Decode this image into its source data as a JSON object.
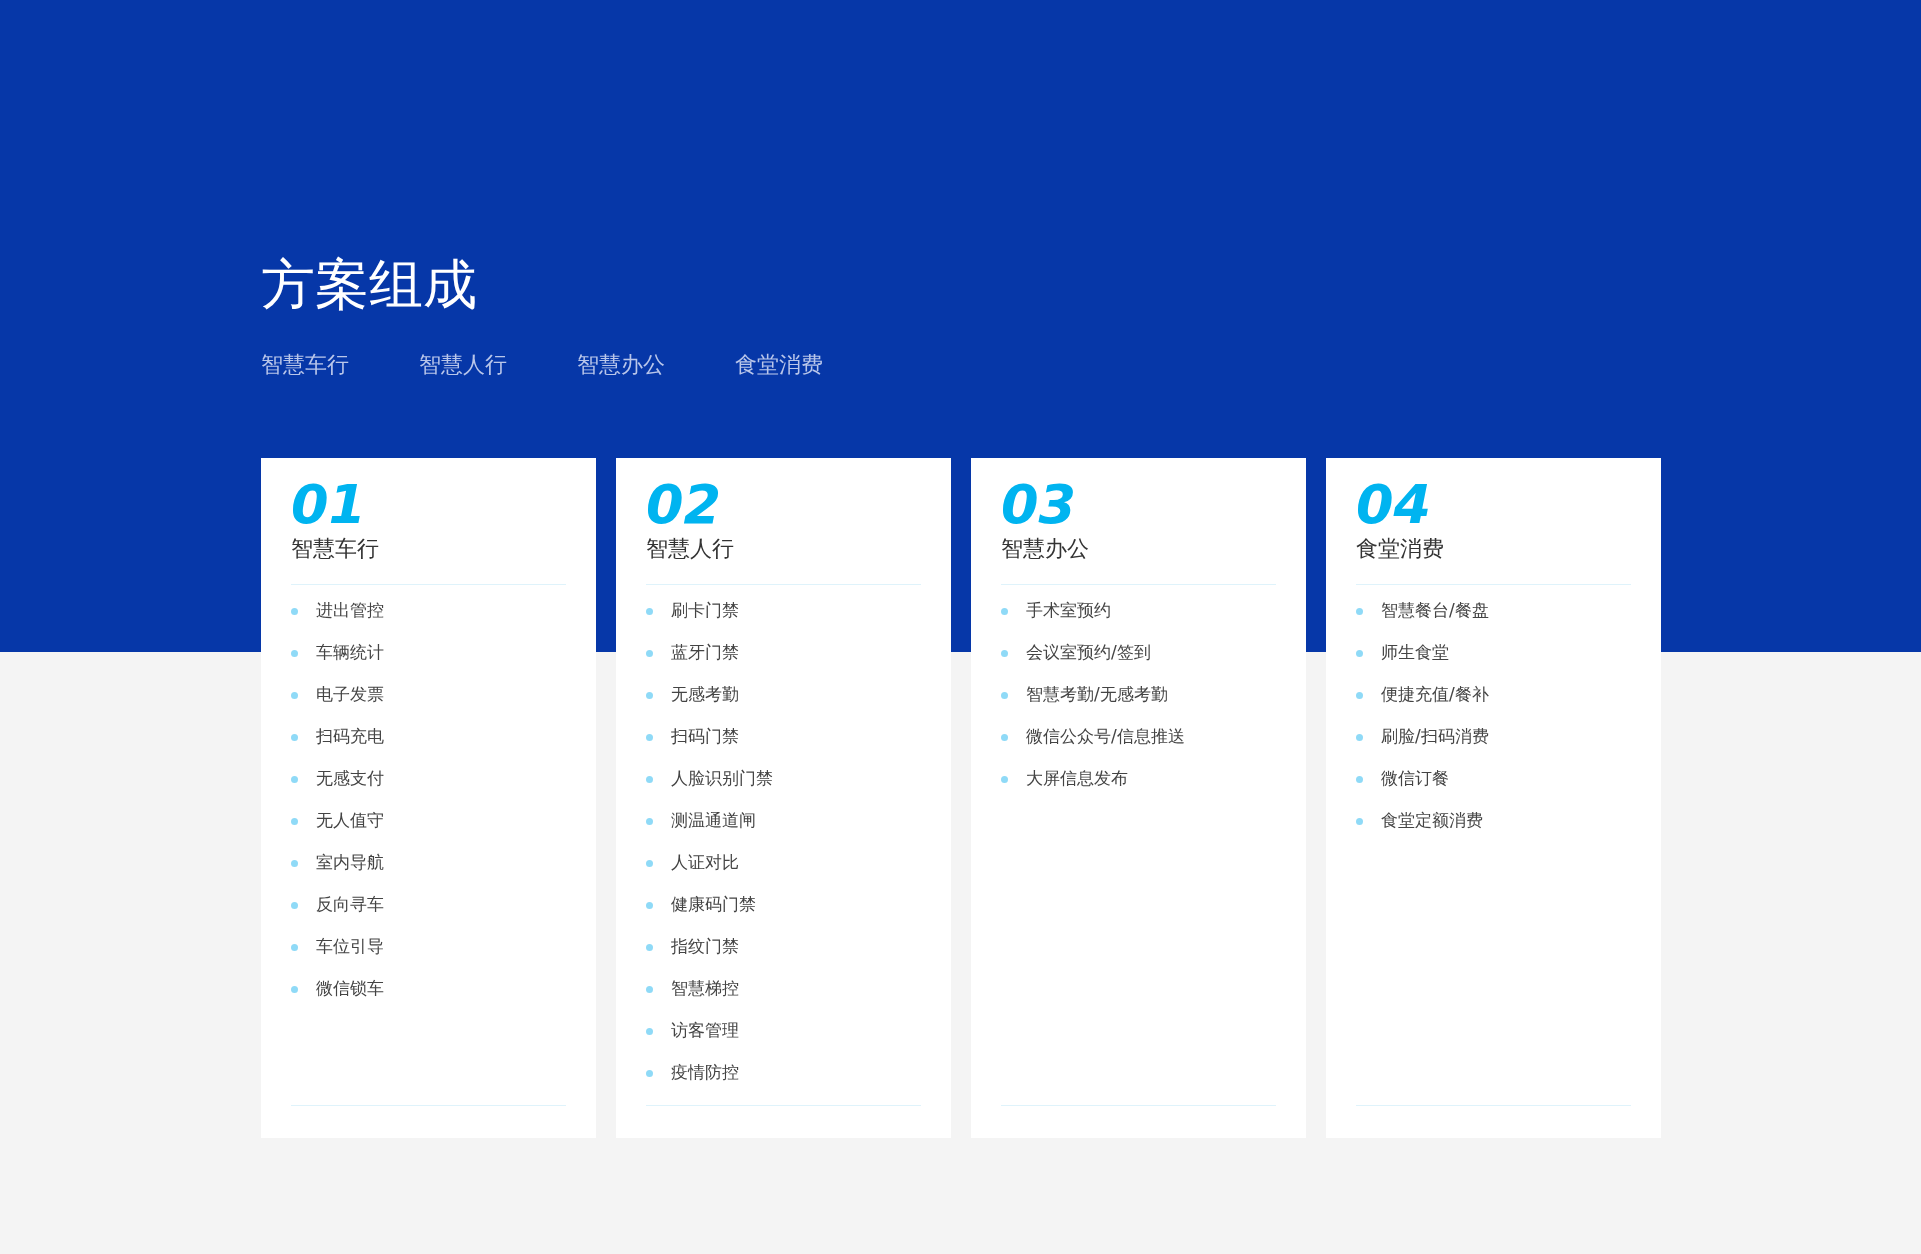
{
  "title": "方案组成",
  "tabs": [
    "智慧车行",
    "智慧人行",
    "智慧办公",
    "食堂消费"
  ],
  "cards": [
    {
      "number": "01",
      "name": "智慧车行",
      "items": [
        "进出管控",
        "车辆统计",
        "电子发票",
        "扫码充电",
        "无感支付",
        "无人值守",
        "室内导航",
        "反向寻车",
        "车位引导",
        "微信锁车"
      ]
    },
    {
      "number": "02",
      "name": "智慧人行",
      "items": [
        "刷卡门禁",
        "蓝牙门禁",
        "无感考勤",
        "扫码门禁",
        "人脸识别门禁",
        "测温通道闸",
        "人证对比",
        "健康码门禁",
        "指纹门禁",
        "智慧梯控",
        "访客管理",
        "疫情防控"
      ]
    },
    {
      "number": "03",
      "name": "智慧办公",
      "items": [
        "手术室预约",
        "会议室预约/签到",
        "智慧考勤/无感考勤",
        "微信公众号/信息推送",
        "大屏信息发布"
      ]
    },
    {
      "number": "04",
      "name": "食堂消费",
      "items": [
        "智慧餐台/餐盘",
        "师生食堂",
        "便捷充值/餐补",
        "刷脸/扫码消费",
        "微信订餐",
        "食堂定额消费"
      ]
    }
  ]
}
